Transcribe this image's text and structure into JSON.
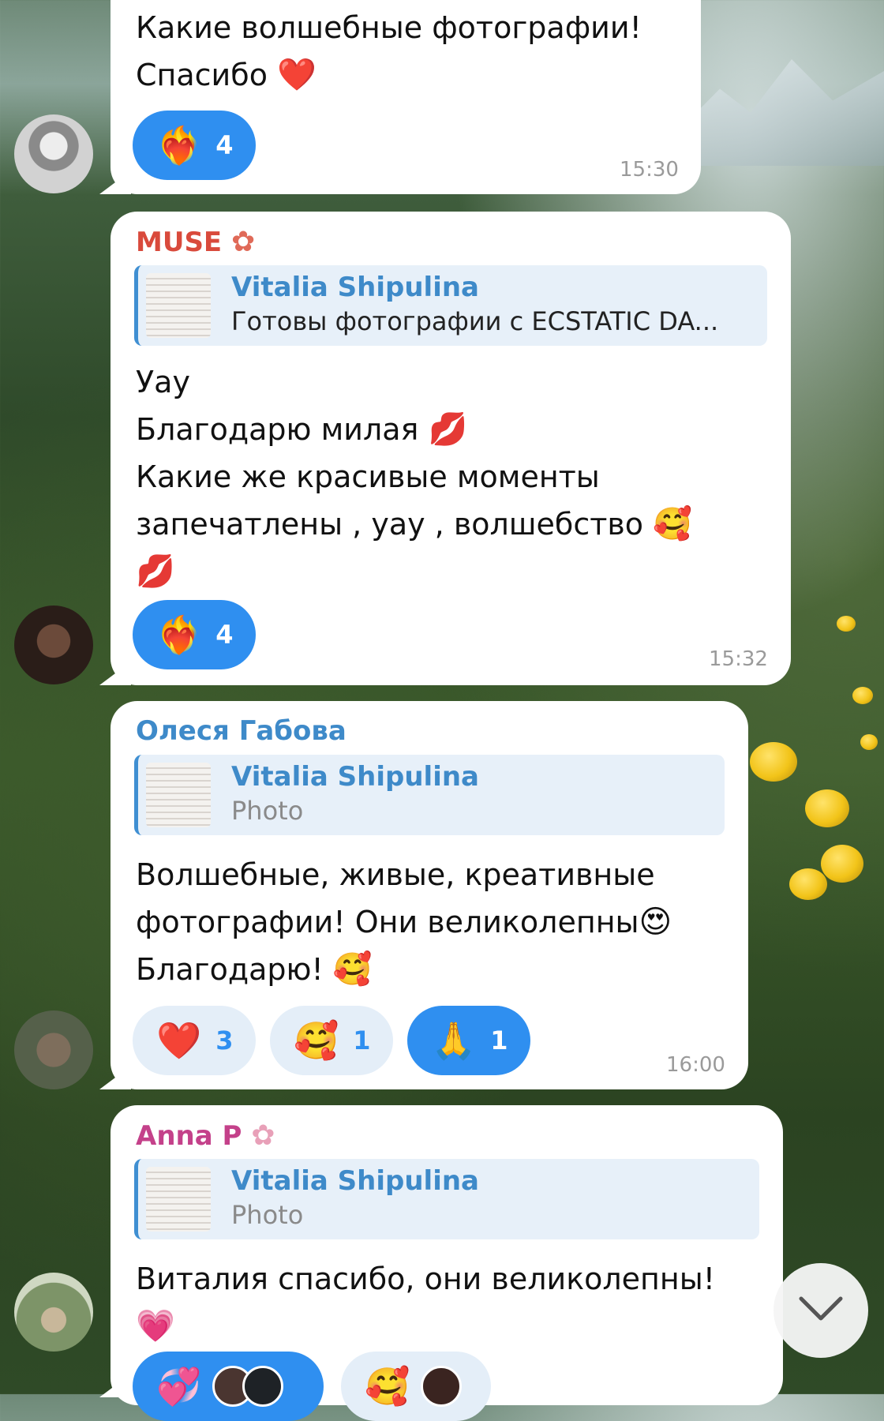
{
  "messages": [
    {
      "text_lines": [
        "Какие волшебные фотографии!",
        "Спасибо"
      ],
      "text_emoji": "❤️",
      "reactions": [
        {
          "emoji": "❤️‍🔥",
          "count": "4",
          "active": true
        }
      ],
      "time": "15:30"
    },
    {
      "sender": "MUSE",
      "sender_color": "#d94a3c",
      "sender_icon": "lotus-icon",
      "reply": {
        "name": "Vitalia Shipulina",
        "text": "Готовы фотографии с ECSTATIC DA..."
      },
      "lines": [
        "Уау",
        "Благодарю милая",
        "Какие же красивые моменты",
        "запечатлены , уау , волшебство"
      ],
      "line_emojis": [
        "",
        "💋",
        "",
        "🥰",
        "💋"
      ],
      "reactions": [
        {
          "emoji": "❤️‍🔥",
          "count": "4",
          "active": true
        }
      ],
      "time": "15:32"
    },
    {
      "sender": "Олеся Габова",
      "sender_color": "#3e8ac9",
      "reply": {
        "name": "Vitalia Shipulina",
        "text": "Photo"
      },
      "lines": [
        "Волшебные, живые, креативные",
        "фотографии! Они великолепны",
        "Благодарю!"
      ],
      "line_emojis": [
        "",
        "😍",
        "🥰"
      ],
      "reactions": [
        {
          "emoji": "❤️",
          "count": "3",
          "active": false
        },
        {
          "emoji": "🥰",
          "count": "1",
          "active": false
        },
        {
          "emoji": "🙏",
          "count": "1",
          "active": true
        }
      ],
      "time": "16:00"
    },
    {
      "sender": "Anna P",
      "sender_color": "#c4418a",
      "sender_icon": "flower-icon",
      "reply": {
        "name": "Vitalia Shipulina",
        "text": "Photo"
      },
      "lines": [
        "Виталия спасибо, они великолепны!"
      ],
      "line_emojis": [
        "💗"
      ],
      "reactions": [
        {
          "emoji": "💞",
          "active": true
        },
        {
          "emoji": "🥰",
          "active": false
        }
      ]
    }
  ],
  "scroll_button_icon": "chevron-down-icon",
  "colors": {
    "accent": "#2f8ff0",
    "reply_bg": "#e7f0f9",
    "reply_bar": "#3f8fd2"
  }
}
